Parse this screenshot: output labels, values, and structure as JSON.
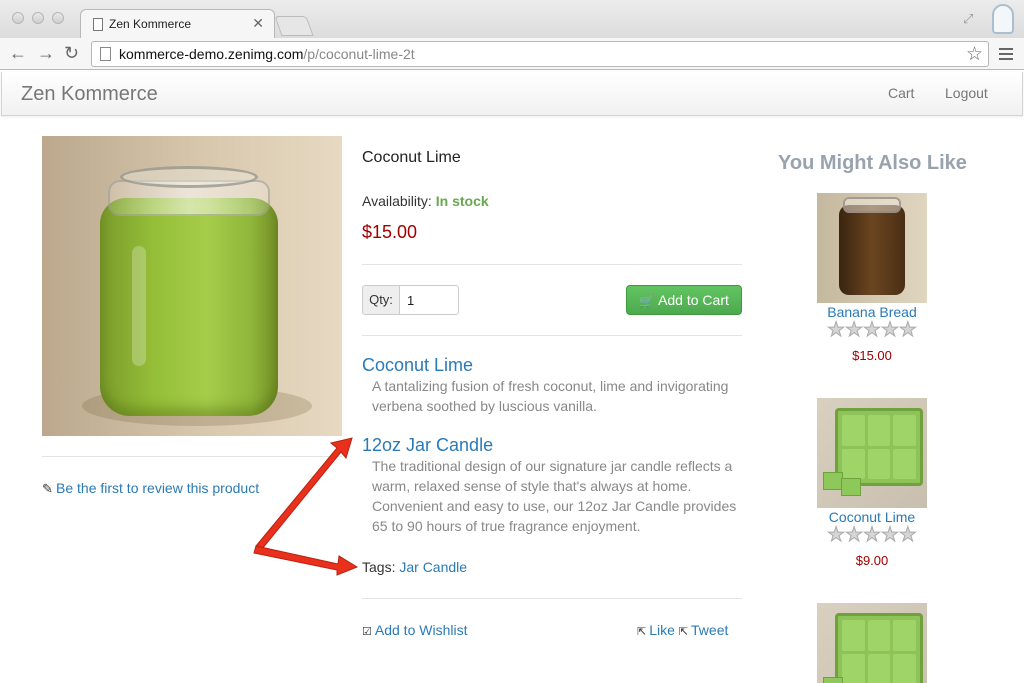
{
  "browser": {
    "tab_title": "Zen Kommerce",
    "url_host": "kommerce-demo.zenimg.com",
    "url_path": "/p/coconut-lime-2t"
  },
  "navbar": {
    "brand": "Zen Kommerce",
    "cart": "Cart",
    "logout": "Logout"
  },
  "product": {
    "name": "Coconut Lime",
    "availability_label": "Availability:",
    "availability_value": "In stock",
    "price": "$15.00",
    "qty_label": "Qty:",
    "qty_value": "1",
    "add_to_cart": "Add to Cart",
    "review_link": "Be the first to review this product",
    "sections": [
      {
        "title": "Coconut Lime",
        "description": "A tantalizing fusion of fresh coconut, lime and invigorating verbena soothed by luscious vanilla."
      },
      {
        "title": "12oz Jar Candle",
        "description": "The traditional design of our signature jar candle reflects a warm, relaxed sense of style that's always at home. Convenient and easy to use, our 12oz Jar Candle provides 65 to 90 hours of true fragrance enjoyment."
      }
    ],
    "tags_label": "Tags:",
    "tag": "Jar Candle",
    "wishlist": "Add to Wishlist",
    "like": "Like",
    "tweet": "Tweet"
  },
  "recommendations": {
    "title": "You Might Also Like",
    "items": [
      {
        "name": "Banana Bread",
        "price": "$15.00",
        "rating": 0,
        "stars": "★★★★★"
      },
      {
        "name": "Coconut Lime",
        "price": "$9.00",
        "rating": 0,
        "stars": "★★★★★"
      },
      {
        "name": "",
        "price": "",
        "rating": 0,
        "stars": ""
      }
    ]
  },
  "colors": {
    "price": "#a00000",
    "in_stock": "#69a84f",
    "link": "#2a7ab8",
    "cart_button": "#5cb85c",
    "annotation_arrow": "#e8301c"
  }
}
